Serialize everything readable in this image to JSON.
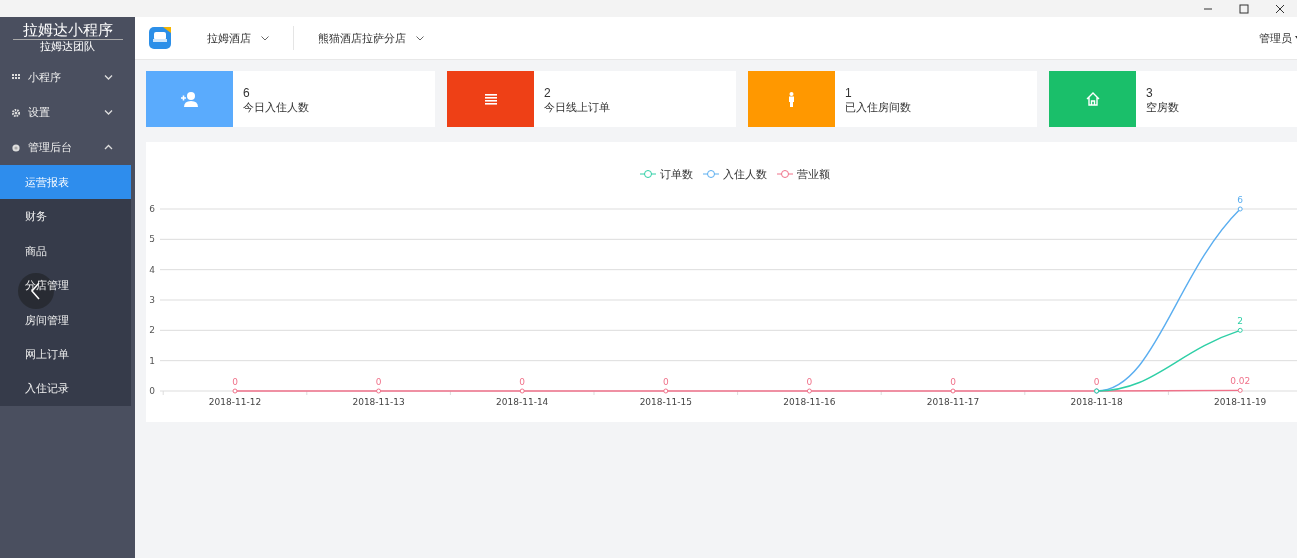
{
  "sidebar": {
    "title": "拉姆达小程序",
    "subtitle": "拉姆达团队",
    "items": [
      {
        "kind": "grid",
        "label": "小程序",
        "expanded": false
      },
      {
        "kind": "gear",
        "label": "设置",
        "expanded": false
      },
      {
        "kind": "dot",
        "label": "管理后台",
        "expanded": true,
        "children": [
          {
            "label": "运营报表",
            "selected": true
          },
          {
            "label": "财务",
            "selected": false
          },
          {
            "label": "商品",
            "selected": false
          },
          {
            "label": "分店管理",
            "selected": false
          },
          {
            "label": "房间管理",
            "selected": false
          },
          {
            "label": "网上订单",
            "selected": false
          },
          {
            "label": "入住记录",
            "selected": false
          }
        ]
      }
    ]
  },
  "header": {
    "selectors": [
      "拉姆酒店",
      "熊猫酒店拉萨分店"
    ],
    "user": "管理员"
  },
  "stats": [
    {
      "kind": "add-user",
      "color": "#5aabfd",
      "value": "6",
      "label": "今日入住人数"
    },
    {
      "kind": "list",
      "color": "#ee4016",
      "value": "2",
      "label": "今日线上订单"
    },
    {
      "kind": "person",
      "color": "#ff9800",
      "value": "1",
      "label": "已入住房间数"
    },
    {
      "kind": "home",
      "color": "#1abf6a",
      "value": "3",
      "label": "空房数"
    }
  ],
  "chart": {
    "chart_data": {
      "type": "line",
      "categories": [
        "2018-11-12",
        "2018-11-13",
        "2018-11-14",
        "2018-11-15",
        "2018-11-16",
        "2018-11-17",
        "2018-11-18",
        "2018-11-19"
      ],
      "ylim": [
        0,
        6
      ],
      "yticks": [
        0,
        1,
        2,
        3,
        4,
        5,
        6
      ],
      "grid": true,
      "legend": "top",
      "series": [
        {
          "name": "订单数",
          "color": "#2ecfa6",
          "marker": "circle",
          "values": [
            null,
            null,
            null,
            null,
            null,
            null,
            0,
            2
          ],
          "value_labels": [
            null,
            null,
            null,
            null,
            null,
            null,
            null,
            "2"
          ]
        },
        {
          "name": "入住人数",
          "color": "#5aaef0",
          "marker": "circle",
          "values": [
            null,
            null,
            null,
            null,
            null,
            null,
            0,
            6
          ],
          "value_labels": [
            null,
            null,
            null,
            null,
            null,
            null,
            null,
            "6"
          ]
        },
        {
          "name": "营业额",
          "color": "#f0728a",
          "marker": "circle",
          "values": [
            0,
            0,
            0,
            0,
            0,
            0,
            0,
            0.02
          ],
          "value_labels": [
            "0",
            "0",
            "0",
            "0",
            "0",
            "0",
            "0",
            "0.02"
          ]
        }
      ]
    }
  }
}
